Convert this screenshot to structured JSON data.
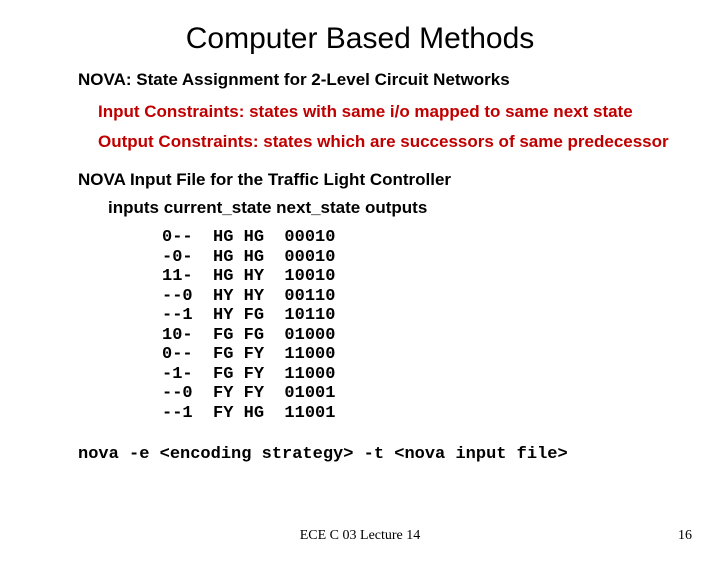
{
  "title": "Computer Based Methods",
  "subtitle": "NOVA: State Assignment for 2-Level Circuit Networks",
  "constraints": {
    "input": "Input Constraints: states with same i/o mapped to same next state",
    "output": "Output Constraints: states which are successors of same predecessor"
  },
  "section_label": "NOVA Input File for the Traffic Light Controller",
  "table_header": "inputs  current_state  next_state  outputs",
  "data_lines": "0--  HG HG  00010\n-0-  HG HG  00010\n11-  HG HY  10010\n--0  HY HY  00110\n--1  HY FG  10110\n10-  FG FG  01000\n0--  FG FY  11000\n-1-  FG FY  11000\n--0  FY FY  01001\n--1  FY HG  11001",
  "command": "nova -e <encoding strategy> -t <nova input file>",
  "footer": {
    "lecture": "ECE C 03 Lecture 14",
    "page": "16"
  },
  "chart_data": {
    "type": "table",
    "columns": [
      "inputs",
      "current_state",
      "next_state",
      "outputs"
    ],
    "rows": [
      {
        "inputs": "0--",
        "current_state": "HG",
        "next_state": "HG",
        "outputs": "00010"
      },
      {
        "inputs": "-0-",
        "current_state": "HG",
        "next_state": "HG",
        "outputs": "00010"
      },
      {
        "inputs": "11-",
        "current_state": "HG",
        "next_state": "HY",
        "outputs": "10010"
      },
      {
        "inputs": "--0",
        "current_state": "HY",
        "next_state": "HY",
        "outputs": "00110"
      },
      {
        "inputs": "--1",
        "current_state": "HY",
        "next_state": "FG",
        "outputs": "10110"
      },
      {
        "inputs": "10-",
        "current_state": "FG",
        "next_state": "FG",
        "outputs": "01000"
      },
      {
        "inputs": "0--",
        "current_state": "FG",
        "next_state": "FY",
        "outputs": "11000"
      },
      {
        "inputs": "-1-",
        "current_state": "FG",
        "next_state": "FY",
        "outputs": "11000"
      },
      {
        "inputs": "--0",
        "current_state": "FY",
        "next_state": "FY",
        "outputs": "01001"
      },
      {
        "inputs": "--1",
        "current_state": "FY",
        "next_state": "HG",
        "outputs": "11001"
      }
    ]
  }
}
